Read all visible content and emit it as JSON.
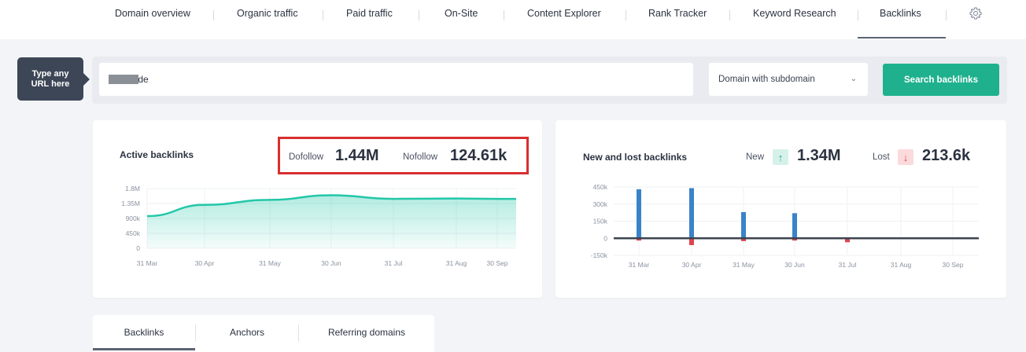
{
  "nav": {
    "items": [
      {
        "label": "Domain overview"
      },
      {
        "label": "Organic traffic"
      },
      {
        "label": "Paid traffic"
      },
      {
        "label": "On-Site"
      },
      {
        "label": "Content Explorer"
      },
      {
        "label": "Rank Tracker"
      },
      {
        "label": "Keyword Research"
      },
      {
        "label": "Backlinks"
      }
    ],
    "active": "Backlinks",
    "settings_icon": "gear-icon"
  },
  "search": {
    "hint": "Type any URL here",
    "url_value": ".de",
    "scope_selected": "Domain with subdomain",
    "button_label": "Search backlinks"
  },
  "active_backlinks": {
    "title": "Active backlinks",
    "dofollow_label": "Dofollow",
    "dofollow_value": "1.44M",
    "nofollow_label": "Nofollow",
    "nofollow_value": "124.61k"
  },
  "new_lost": {
    "title": "New and lost backlinks",
    "new_label": "New",
    "new_value": "1.34M",
    "lost_label": "Lost",
    "lost_value": "213.6k"
  },
  "tabs": [
    {
      "label": "Backlinks"
    },
    {
      "label": "Anchors"
    },
    {
      "label": "Referring domains"
    }
  ],
  "colors": {
    "accent_green": "#1fb18e",
    "area_teal": "#22c7a8",
    "new_bar": "#3a83c9",
    "lost_bar": "#e0424f",
    "highlight_red": "#d82f2f"
  },
  "chart_data": [
    {
      "type": "area",
      "title": "Active backlinks",
      "x": [
        "31 Mar",
        "30 Apr",
        "31 May",
        "30 Jun",
        "31 Jul",
        "31 Aug",
        "30 Sep"
      ],
      "series": [
        {
          "values": [
            970000,
            1310000,
            1460000,
            1600000,
            1490000,
            1500000,
            1490000
          ]
        }
      ],
      "yticks": [
        "1.8M",
        "1.35M",
        "900k",
        "450k",
        "0"
      ],
      "ylim": [
        0,
        1800000
      ]
    },
    {
      "type": "bar",
      "title": "New and lost backlinks",
      "x": [
        "31 Mar",
        "30 Apr",
        "31 May",
        "30 Jun",
        "31 Jul",
        "31 Aug",
        "30 Sep"
      ],
      "series": [
        {
          "name": "New",
          "values": [
            430000,
            440000,
            230000,
            220000,
            0,
            0,
            0
          ]
        },
        {
          "name": "Lost",
          "values": [
            -20000,
            -60000,
            -25000,
            -20000,
            -35000,
            0,
            -5000
          ]
        }
      ],
      "yticks": [
        "450k",
        "300k",
        "150k",
        "0",
        "-150k"
      ],
      "ylim": [
        -150000,
        450000
      ]
    }
  ]
}
